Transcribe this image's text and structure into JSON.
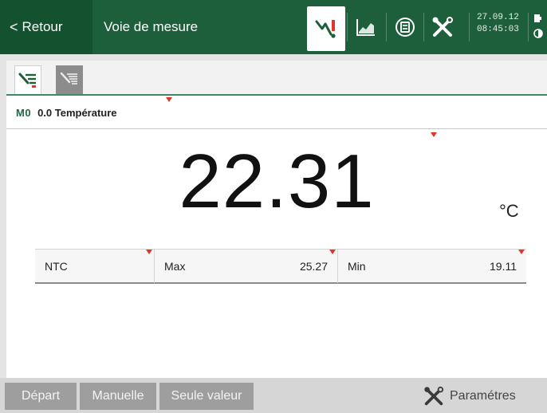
{
  "header": {
    "back_label": "Retour",
    "back_glyph": "<",
    "title": "Voie de mesure",
    "date": "27.09.12",
    "time": "08:45:03",
    "icons": [
      "measuring-channel-icon",
      "chart-icon",
      "memory-icon",
      "settings-icon",
      "battery-icon",
      "brightness-icon"
    ]
  },
  "view_tabs": [
    "single-channel-view-icon",
    "multi-channel-view-icon"
  ],
  "channel": {
    "id": "M0",
    "name": "0.0 Température"
  },
  "reading": {
    "value": "22.31",
    "unit": "°C"
  },
  "info": {
    "sensor": "NTC",
    "max_label": "Max",
    "max_value": "25.27",
    "min_label": "Min",
    "min_value": "19.11"
  },
  "footer": {
    "start_label": "Départ",
    "manual_label": "Manuelle",
    "single_value_label": "Seule valeur",
    "params_label": "Paramétres"
  },
  "colors": {
    "header_bg": "#1d5e3b",
    "accent": "#3f8a64",
    "marker": "#e0362a",
    "button_bg": "#9e9e9e"
  }
}
